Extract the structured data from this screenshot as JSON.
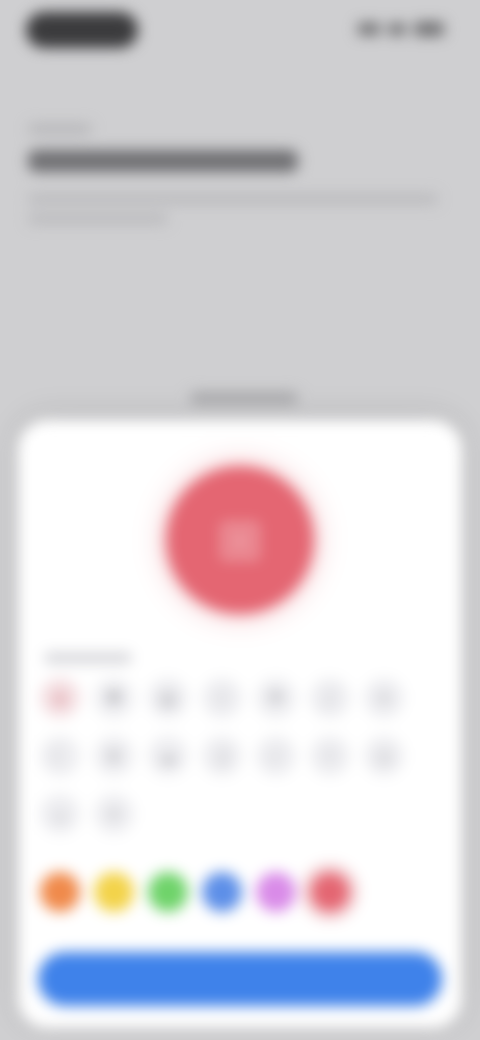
{
  "colors": {
    "background": "#cfcfd1",
    "sheet": "#ffffff",
    "icon_preview": "#e46672",
    "primary_button": "#3f82ea"
  },
  "preview": {
    "icon": "grid-icon",
    "glyph": "⊞"
  },
  "icon_grid": [
    {
      "icon": "star-icon",
      "glyph": "★",
      "selected": true
    },
    {
      "icon": "heart-icon",
      "glyph": "♥",
      "selected": false
    },
    {
      "icon": "book-icon",
      "glyph": "▤",
      "selected": false
    },
    {
      "icon": "bolt-icon",
      "glyph": "⚡",
      "selected": false
    },
    {
      "icon": "flag-icon",
      "glyph": "⚑",
      "selected": false
    },
    {
      "icon": "music-icon",
      "glyph": "♪",
      "selected": false
    },
    {
      "icon": "sun-icon",
      "glyph": "☀",
      "selected": false
    },
    {
      "icon": "moon-icon",
      "glyph": "☾",
      "selected": false
    },
    {
      "icon": "leaf-icon",
      "glyph": "❦",
      "selected": false
    },
    {
      "icon": "cloud-icon",
      "glyph": "☁",
      "selected": false
    },
    {
      "icon": "bell-icon",
      "glyph": "♫",
      "selected": false
    },
    {
      "icon": "check-icon",
      "glyph": "✓",
      "selected": false
    },
    {
      "icon": "pin-icon",
      "glyph": "⌖",
      "selected": false
    },
    {
      "icon": "clock-icon",
      "glyph": "◷",
      "selected": false
    },
    {
      "icon": "cup-icon",
      "glyph": "☕",
      "selected": false
    },
    {
      "icon": "gift-icon",
      "glyph": "✦",
      "selected": false
    }
  ],
  "color_swatches": [
    {
      "name": "orange",
      "hex": "#f08a4b",
      "selected": false
    },
    {
      "name": "yellow",
      "hex": "#f3d34a",
      "selected": false
    },
    {
      "name": "green",
      "hex": "#6fd36a",
      "selected": false
    },
    {
      "name": "blue",
      "hex": "#5d8fe8",
      "selected": false
    },
    {
      "name": "purple",
      "hex": "#d98be8",
      "selected": false
    },
    {
      "name": "red",
      "hex": "#e46672",
      "selected": true
    }
  ]
}
